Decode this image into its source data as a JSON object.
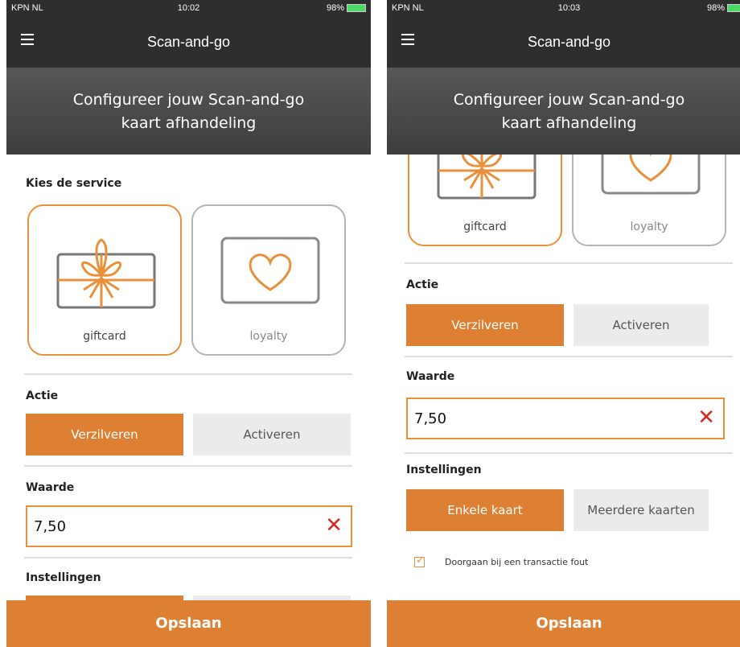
{
  "colors": {
    "accent": "#de8033",
    "header": "#2e2e2e",
    "clear_x": "#d42a20"
  },
  "screens": [
    {
      "status": {
        "carrier": "KPN NL",
        "time": "10:02",
        "battery": "98%"
      },
      "nav_title": "Scan-and-go",
      "banner": {
        "line1": "Configureer jouw Scan-and-go",
        "line2": "kaart afhandeling"
      },
      "service_label": "Kies de service",
      "cards": [
        {
          "label": "giftcard",
          "selected": true
        },
        {
          "label": "loyalty",
          "selected": false
        }
      ],
      "actie_label": "Actie",
      "actie_options": [
        {
          "label": "Verzilveren",
          "active": true
        },
        {
          "label": "Activeren",
          "active": false
        }
      ],
      "waarde_label": "Waarde",
      "waarde_value": "7,50",
      "instellingen_label": "Instellingen",
      "save_label": "Opslaan"
    },
    {
      "status": {
        "carrier": "KPN NL",
        "time": "10:03",
        "battery": "98%"
      },
      "nav_title": "Scan-and-go",
      "banner": {
        "line1": "Configureer jouw Scan-and-go",
        "line2": "kaart afhandeling"
      },
      "cards": [
        {
          "label": "giftcard",
          "selected": true
        },
        {
          "label": "loyalty",
          "selected": false
        }
      ],
      "actie_label": "Actie",
      "actie_options": [
        {
          "label": "Verzilveren",
          "active": true
        },
        {
          "label": "Activeren",
          "active": false
        }
      ],
      "waarde_label": "Waarde",
      "waarde_value": "7,50",
      "instellingen_label": "Instellingen",
      "instellingen_options": [
        {
          "label": "Enkele kaart",
          "active": true
        },
        {
          "label": "Meerdere kaarten",
          "active": false
        }
      ],
      "continue_checkbox": {
        "label": "Doorgaan bij een transactie fout",
        "checked": true
      },
      "save_label": "Opslaan"
    }
  ]
}
